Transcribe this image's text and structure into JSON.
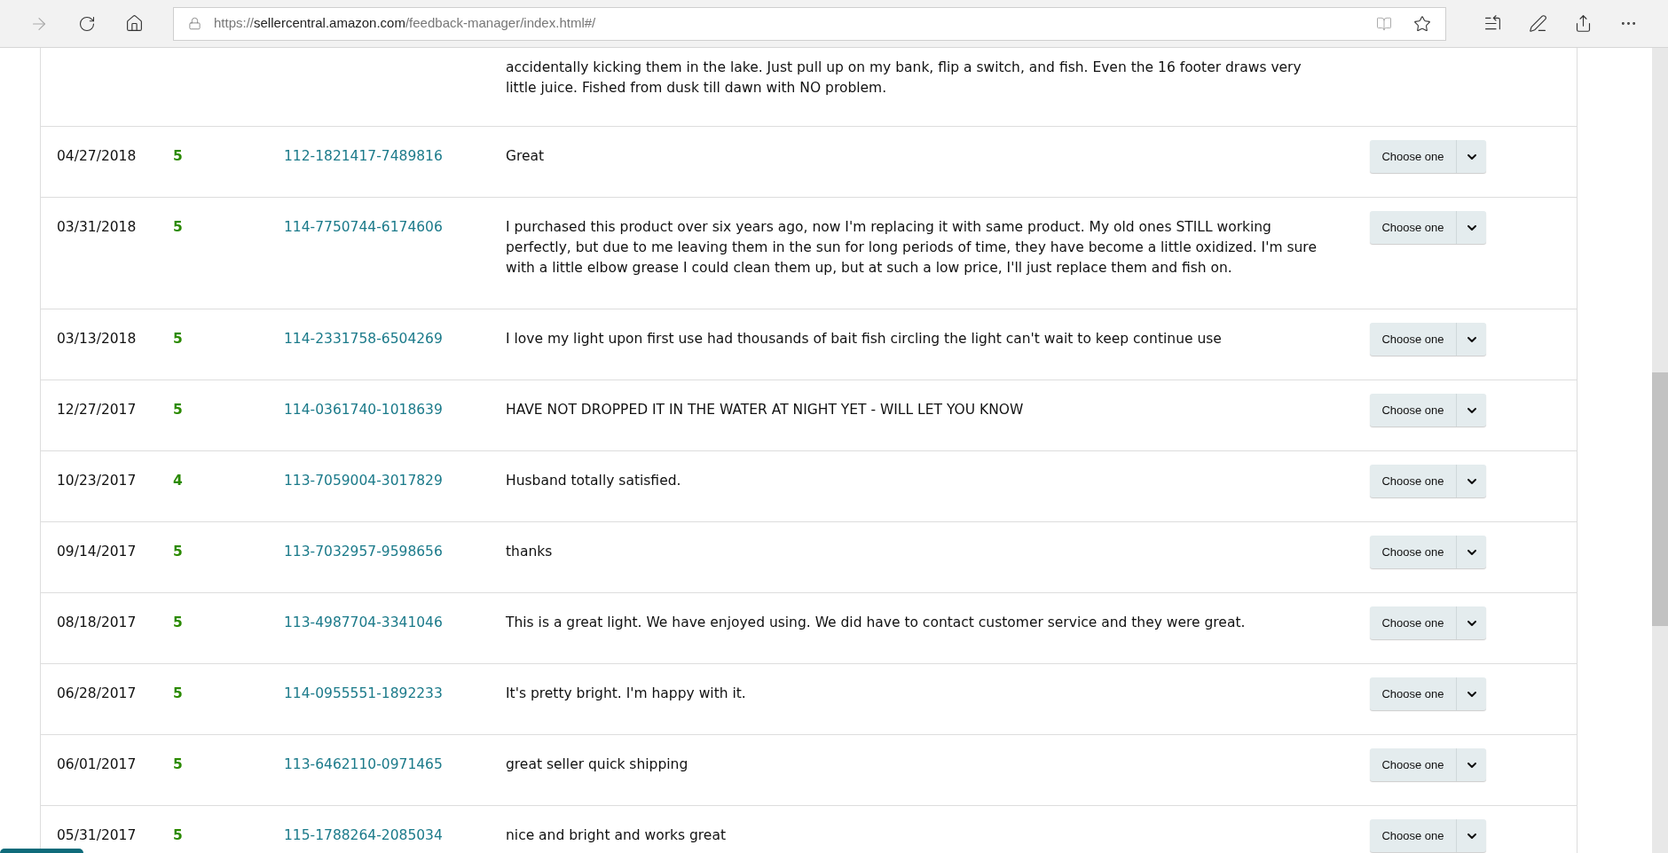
{
  "browser": {
    "url_scheme": "https://",
    "url_host": "sellercentral.amazon.com",
    "url_path": "/feedback-manager/index.html#/"
  },
  "partial_row": {
    "comment": "accidentally kicking them in the lake. Just pull up on my bank, flip a switch, and fish. Even the 16 footer draws very little juice. Fished from dusk till dawn with NO problem."
  },
  "rows": [
    {
      "date": "04/27/2018",
      "rating": "5",
      "order": "112-1821417-7489816",
      "comment": "Great",
      "action": "Choose one"
    },
    {
      "date": "03/31/2018",
      "rating": "5",
      "order": "114-7750744-6174606",
      "comment": "I purchased this product over six years ago, now I'm replacing it with same product. My old ones STILL working perfectly, but due to me leaving them in the sun for long periods of time, they have become a little oxidized. I'm sure with a little elbow grease I could clean them up, but at such a low price, I'll just replace them and fish on.",
      "action": "Choose one"
    },
    {
      "date": "03/13/2018",
      "rating": "5",
      "order": "114-2331758-6504269",
      "comment": "I love my light upon first use had thousands of bait fish circling the light can't wait to keep continue use",
      "action": "Choose one"
    },
    {
      "date": "12/27/2017",
      "rating": "5",
      "order": "114-0361740-1018639",
      "comment": "HAVE NOT DROPPED IT IN THE WATER AT NIGHT YET - WILL LET YOU KNOW",
      "action": "Choose one"
    },
    {
      "date": "10/23/2017",
      "rating": "4",
      "order": "113-7059004-3017829",
      "comment": "Husband totally satisfied.",
      "action": "Choose one"
    },
    {
      "date": "09/14/2017",
      "rating": "5",
      "order": "113-7032957-9598656",
      "comment": "thanks",
      "action": "Choose one"
    },
    {
      "date": "08/18/2017",
      "rating": "5",
      "order": "113-4987704-3341046",
      "comment": "This is a great light. We have enjoyed using. We did have to contact customer service and they were great.",
      "action": "Choose one"
    },
    {
      "date": "06/28/2017",
      "rating": "5",
      "order": "114-0955551-1892233",
      "comment": "It's pretty bright. I'm happy with it.",
      "action": "Choose one"
    },
    {
      "date": "06/01/2017",
      "rating": "5",
      "order": "113-6462110-0971465",
      "comment": "great seller quick shipping",
      "action": "Choose one"
    },
    {
      "date": "05/31/2017",
      "rating": "5",
      "order": "115-1788264-2085034",
      "comment": "nice and bright and works great",
      "action": "Choose one"
    }
  ]
}
